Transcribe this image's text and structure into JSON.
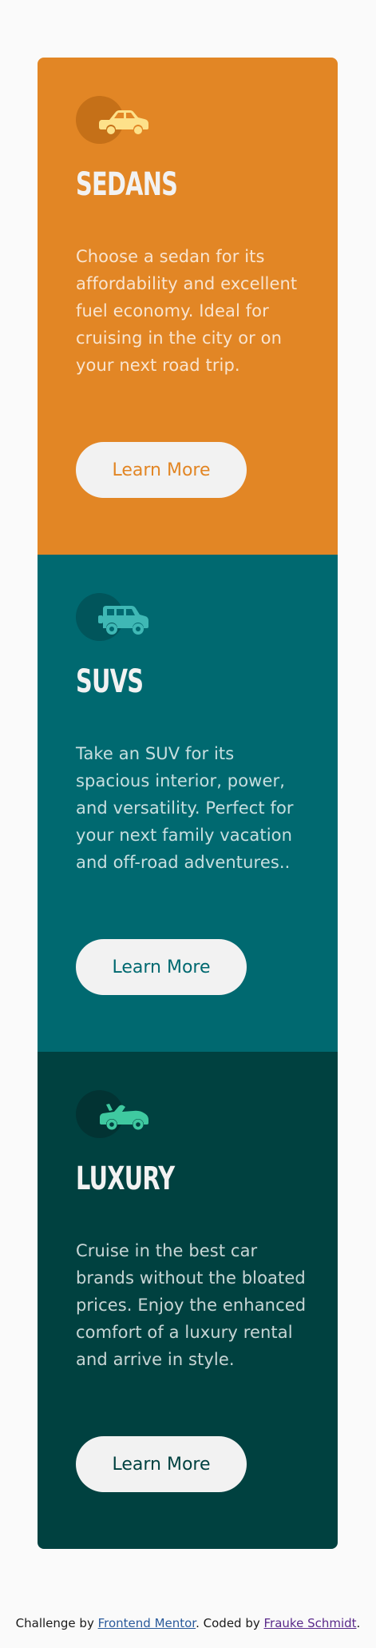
{
  "cards": [
    {
      "icon": "sedan-car-icon",
      "title": "SEDANS",
      "description": "Choose a sedan for its affordability and excellent fuel economy. Ideal for cruising in the city or on your next road trip.",
      "button_label": "Learn More",
      "color": "#e28625"
    },
    {
      "icon": "suv-car-icon",
      "title": "SUVS",
      "description": "Take an SUV for its spacious interior, power, and versatility. Perfect for your next family vacation and off-road adventures..",
      "button_label": "Learn More",
      "color": "#006970"
    },
    {
      "icon": "luxury-car-icon",
      "title": "LUXURY",
      "description": "Cruise in the best car brands without the bloated prices. Enjoy the enhanced comfort of a luxury rental and arrive in style.",
      "button_label": "Learn More",
      "color": "#004140"
    }
  ],
  "attribution": {
    "prefix": "Challenge by ",
    "challenge_link": "Frontend Mentor",
    "middle": ". Coded by ",
    "author_link": "Frauke Schmidt",
    "suffix": "."
  }
}
